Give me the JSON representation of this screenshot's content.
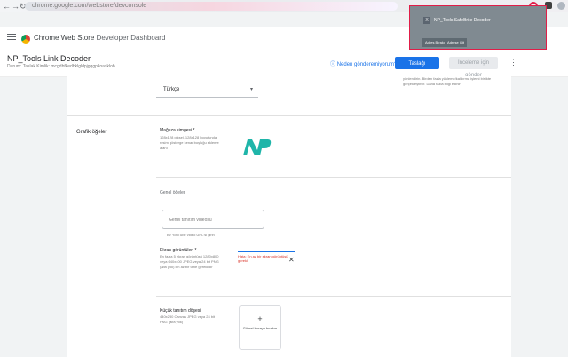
{
  "browser": {
    "url": "chrome.google.com/webstore/devconsole",
    "nav_icons": [
      "arrow-left",
      "arrow-right",
      "reload"
    ]
  },
  "appbar": {
    "title": "Chrome Web Store",
    "subtitle": "Developer Dashboard"
  },
  "item": {
    "name": "NP_Tools Link Decoder",
    "meta": "Durum: Taslak   Kimlik: mcgdbfkedbklgldpjgggpkoasklob"
  },
  "actions": {
    "why": "Neden gönderemiyorum?",
    "save": "Taslağı kaydet",
    "submit": "İnceleme için gönder",
    "more": "⋮"
  },
  "language": {
    "value": "Türkçe"
  },
  "right_note": "yönlendirin. Birden fazla yükleme/kaldırma işlemi birlikte gerçekleştirilir. Daha fazla bilgi edinin",
  "graphics": {
    "section": "Grafik öğeler",
    "store_icon": {
      "label": "Mağaza simgesi *",
      "desc": "128x128 piksel. 128x128 boyutunda resim gösterge kenar boşluğu ekleme alanı"
    },
    "general_label": "Genel öğeler",
    "promo_placeholder": "Genel tanıtım videosu",
    "promo_helper": "Bir YouTube video URL'si girin",
    "screenshots": {
      "label": "Ekran görüntüleri *",
      "desc": "En fazla 5 ekran görüntüsü 1280x800 veya 640x400 JPEG veya 24 bit PNG (alfa yok) En az bir tane gereklidir"
    },
    "screenshot_error": "Hata: En az bir ekran görüntüsü gerekli",
    "small_tile": {
      "label": "Küçük tanıtım döşesi",
      "desc": "440x280 Canvas JPEG veya 24 bit PNG (alfa yok)"
    },
    "upload_label": "Görsel buraya bırakın"
  },
  "popup": {
    "title": "NP_Tools SafeBrite Decoder",
    "actions": "Adres Bırakı | Adrese Git"
  }
}
